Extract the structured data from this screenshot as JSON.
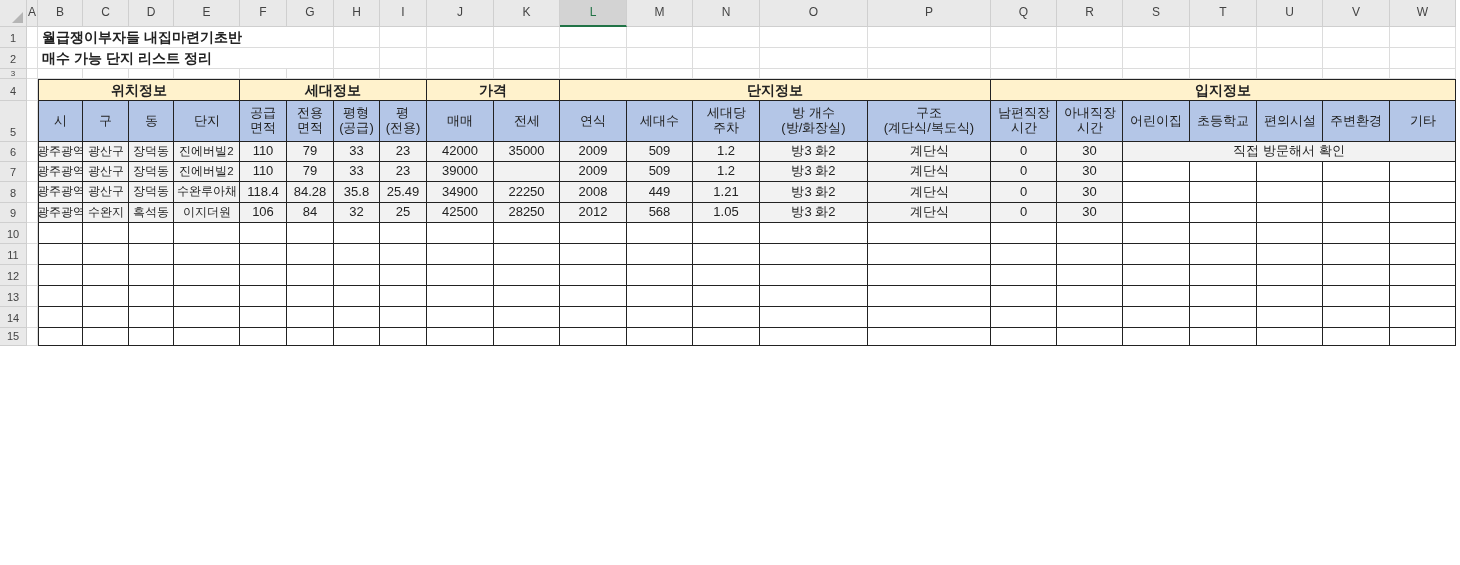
{
  "sheet": {
    "columns": [
      {
        "label": "A",
        "selected": false
      },
      {
        "label": "B",
        "selected": false
      },
      {
        "label": "C",
        "selected": false
      },
      {
        "label": "D",
        "selected": false
      },
      {
        "label": "E",
        "selected": false
      },
      {
        "label": "F",
        "selected": false
      },
      {
        "label": "G",
        "selected": false
      },
      {
        "label": "H",
        "selected": false
      },
      {
        "label": "I",
        "selected": false
      },
      {
        "label": "J",
        "selected": false
      },
      {
        "label": "K",
        "selected": false
      },
      {
        "label": "L",
        "selected": true
      },
      {
        "label": "M",
        "selected": false
      },
      {
        "label": "N",
        "selected": false
      },
      {
        "label": "O",
        "selected": false
      },
      {
        "label": "P",
        "selected": false
      },
      {
        "label": "Q",
        "selected": false
      },
      {
        "label": "R",
        "selected": false
      },
      {
        "label": "S",
        "selected": false
      },
      {
        "label": "T",
        "selected": false
      },
      {
        "label": "U",
        "selected": false
      },
      {
        "label": "V",
        "selected": false
      },
      {
        "label": "W",
        "selected": false
      }
    ],
    "rows": [
      "1",
      "2",
      "3",
      "4",
      "5",
      "6",
      "7",
      "8",
      "9",
      "10",
      "11",
      "12",
      "13",
      "14",
      "15"
    ],
    "title_lines": [
      "월급쟁이부자들 내집마련기초반",
      "매수 가능 단지 리스트 정리"
    ],
    "groups": [
      {
        "label": "위치정보",
        "headers": [
          "시",
          "구",
          "동",
          "단지"
        ]
      },
      {
        "label": "세대정보",
        "headers": [
          "공급\n면적",
          "전용\n면적",
          "평형\n(공급)",
          "평\n(전용)"
        ]
      },
      {
        "label": "가격",
        "headers": [
          "매매",
          "전세"
        ]
      },
      {
        "label": "단지정보",
        "headers": [
          "연식",
          "세대수",
          "세대당\n주차",
          "방 개수\n(방/화장실)",
          "구조\n(계단식/복도식)"
        ]
      },
      {
        "label": "입지정보",
        "headers": [
          "남편직장\n시간",
          "아내직장\n시간",
          "어린이집",
          "초등학교",
          "편의시설",
          "주변환경",
          "기타"
        ]
      }
    ],
    "data_rows": [
      {
        "cells": [
          "광주광역",
          "광산구",
          "장덕동",
          "진에버빌2",
          "110",
          "79",
          "33",
          "23",
          "42000",
          "35000",
          "2009",
          "509",
          "1.2",
          "방3 화2",
          "계단식",
          "0",
          "30"
        ],
        "note": "직접 방문해서 확인"
      },
      {
        "cells": [
          "광주광역",
          "광산구",
          "장덕동",
          "진에버빌2",
          "110",
          "79",
          "33",
          "23",
          "39000",
          null,
          "2009",
          "509",
          "1.2",
          "방3 화2",
          "계단식",
          "0",
          "30"
        ]
      },
      {
        "cells": [
          "광주광역",
          "광산구",
          "장덕동",
          "수완루아채",
          "118.4",
          "84.28",
          "35.8",
          "25.49",
          "34900",
          "22250",
          "2008",
          "449",
          "1.21",
          "방3 화2",
          "계단식",
          "0",
          "30"
        ]
      },
      {
        "cells": [
          "광주광역",
          "수완지",
          "흑석동",
          "이지더원",
          "106",
          "84",
          "32",
          "25",
          "42500",
          "28250",
          "2012",
          "568",
          "1.05",
          "방3 화2",
          "계단식",
          "0",
          "30"
        ]
      }
    ]
  }
}
